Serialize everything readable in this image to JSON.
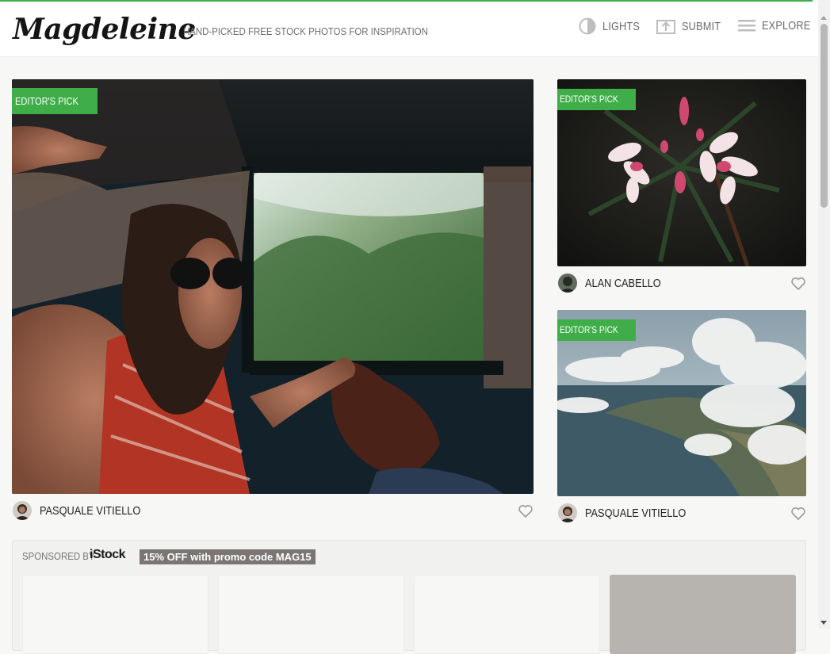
{
  "brand": {
    "logo": "Magdeleine",
    "tagline": "HAND-PICKED FREE STOCK PHOTOS FOR INSPIRATION",
    "accent_color": "#3fae49"
  },
  "nav": [
    {
      "label": "LIGHTS",
      "icon": "half-circle-icon"
    },
    {
      "label": "SUBMIT",
      "icon": "upload-icon"
    },
    {
      "label": "EXPLORE",
      "icon": "menu-icon"
    }
  ],
  "photos": [
    {
      "badge": "EDITOR'S PICK",
      "photographer": "PASQUALE VITIELLO",
      "subject": "woman in car window",
      "icon": "heart-icon"
    },
    {
      "badge": "EDITOR'S PICK",
      "photographer": "ALAN CABELLO",
      "subject": "pink flowers",
      "icon": "heart-icon"
    },
    {
      "badge": "EDITOR'S PICK",
      "photographer": "PASQUALE VITIELLO",
      "subject": "coast with clouds",
      "icon": "heart-icon"
    }
  ],
  "sponsor": {
    "label": "SPONSORED BY",
    "brand": "iStock",
    "promo": "15% OFF with promo code MAG15"
  }
}
